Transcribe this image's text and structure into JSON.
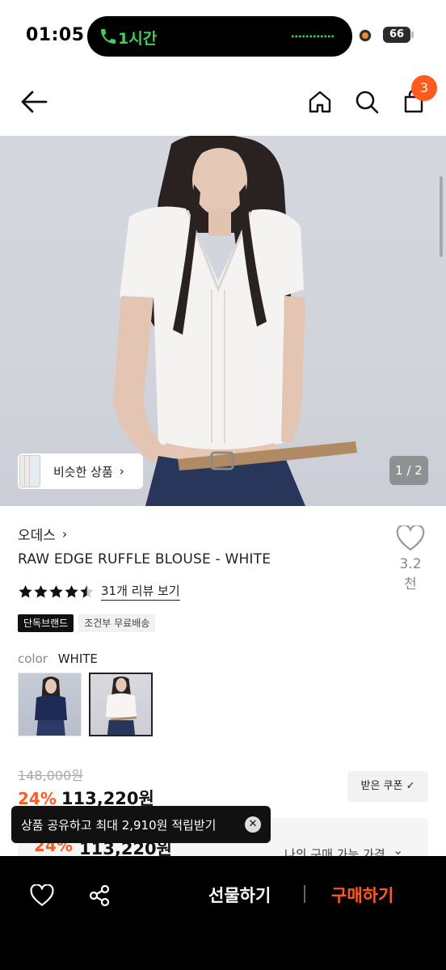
{
  "status_bar": {
    "time": "01:05",
    "call_label": "1시간",
    "battery": "66"
  },
  "top_nav": {
    "cart_count": "3"
  },
  "hero": {
    "similar_label": "비슷한 상품",
    "page_counter": "1 / 2"
  },
  "product": {
    "brand": "오데스",
    "title": "RAW EDGE RUFFLE BLOUSE - WHITE",
    "wish_count": "3.2천",
    "rating": 4.5,
    "review_link": "31개 리뷰 보기",
    "tags": [
      "단독브랜드",
      "조건부 무료배송"
    ],
    "color_label": "color",
    "color_value": "WHITE",
    "swatches": [
      "navy",
      "white"
    ]
  },
  "price": {
    "original": "148,000원",
    "discount": "24%",
    "price": "113,220원",
    "coupon_label": "받은 쿠폰 ✓"
  },
  "benefit": {
    "discount": "24%",
    "price": "113,220원",
    "label": "나의 구매 가능 가격"
  },
  "toast": {
    "text": "상품 공유하고 최대 2,910원 적립받기"
  },
  "bottom_bar": {
    "gift_label": "선물하기",
    "buy_label": "구매하기"
  },
  "colors": {
    "accent": "#ff5a1f",
    "call_green": "#3fd15c"
  }
}
